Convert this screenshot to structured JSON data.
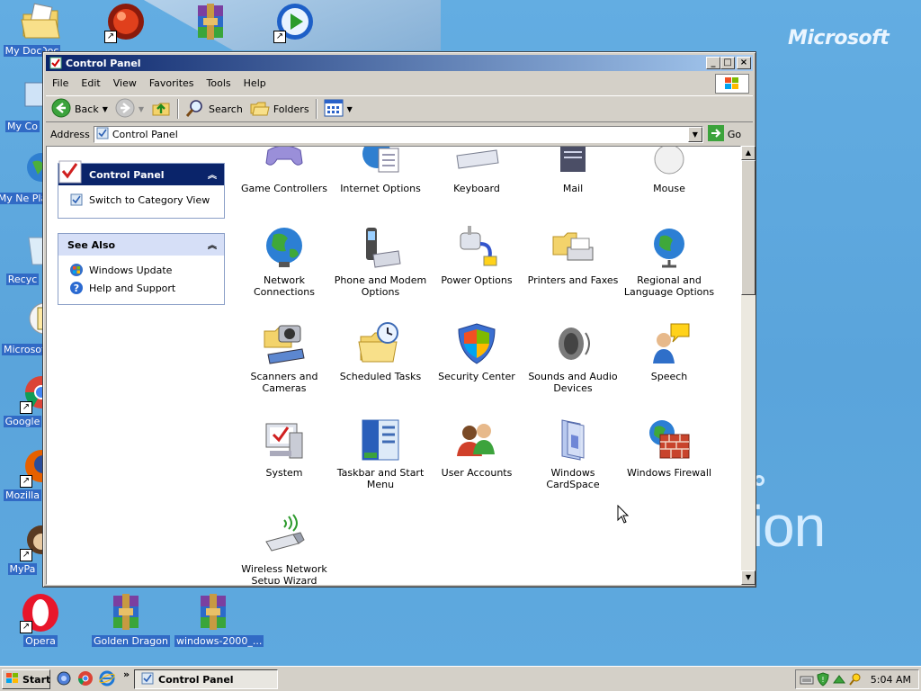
{
  "window": {
    "title": "Control Panel",
    "menu": [
      "File",
      "Edit",
      "View",
      "Favorites",
      "Tools",
      "Help"
    ],
    "toolbar": {
      "back": "Back",
      "search": "Search",
      "folders": "Folders"
    },
    "address": {
      "label": "Address",
      "value": "Control Panel",
      "go": "Go"
    }
  },
  "panes": {
    "control_panel": {
      "title": "Control Panel",
      "link": "Switch to Category View"
    },
    "see_also": {
      "title": "See Also",
      "links": [
        "Windows Update",
        "Help and Support"
      ]
    }
  },
  "items": [
    {
      "label": "Game Controllers"
    },
    {
      "label": "Internet Options"
    },
    {
      "label": "Keyboard"
    },
    {
      "label": "Mail"
    },
    {
      "label": "Mouse"
    },
    {
      "label": "Network Connections"
    },
    {
      "label": "Phone and Modem Options"
    },
    {
      "label": "Power Options"
    },
    {
      "label": "Printers and Faxes"
    },
    {
      "label": "Regional and Language Options"
    },
    {
      "label": "Scanners and Cameras"
    },
    {
      "label": "Scheduled Tasks"
    },
    {
      "label": "Security Center"
    },
    {
      "label": "Sounds and Audio Devices"
    },
    {
      "label": "Speech"
    },
    {
      "label": "System"
    },
    {
      "label": "Taskbar and Start Menu"
    },
    {
      "label": "User Accounts"
    },
    {
      "label": "Windows CardSpace"
    },
    {
      "label": "Windows Firewall"
    },
    {
      "label": "Wireless Network Setup Wizard"
    }
  ],
  "desktop": {
    "brand": "Microsoft",
    "wallpaper_text": "tion",
    "icons": [
      "My Doc",
      "My Co",
      "My Ne Pla",
      "Recyc",
      "Microsoft",
      "Google",
      "Mozilla",
      "MyPa",
      "Opera",
      "Golden Dragon",
      "windows-2000_..."
    ]
  },
  "taskbar": {
    "start": "Start",
    "more": "»",
    "task": "Control Panel",
    "clock": "5:04 AM"
  }
}
